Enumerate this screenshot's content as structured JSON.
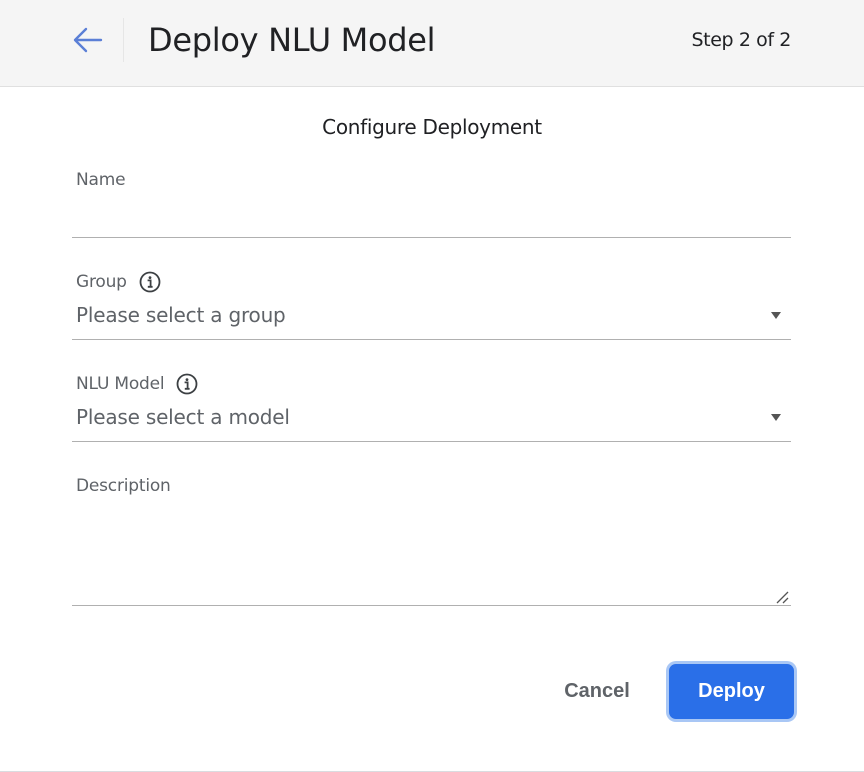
{
  "header": {
    "back_icon": "arrow-left-icon",
    "title": "Deploy NLU Model",
    "step": "Step 2 of 2"
  },
  "form": {
    "section_title": "Configure Deployment",
    "name": {
      "label": "Name",
      "value": ""
    },
    "group": {
      "label": "Group",
      "value": "Please select a group",
      "info_icon": "info-icon"
    },
    "nlu_model": {
      "label": "NLU Model",
      "value": "Please select a model",
      "info_icon": "info-icon"
    },
    "description": {
      "label": "Description",
      "value": ""
    }
  },
  "actions": {
    "cancel_label": "Cancel",
    "deploy_label": "Deploy"
  },
  "colors": {
    "accent": "#2a6fe8",
    "header_bg": "#f5f5f5",
    "back_arrow": "#5b7fd6"
  }
}
